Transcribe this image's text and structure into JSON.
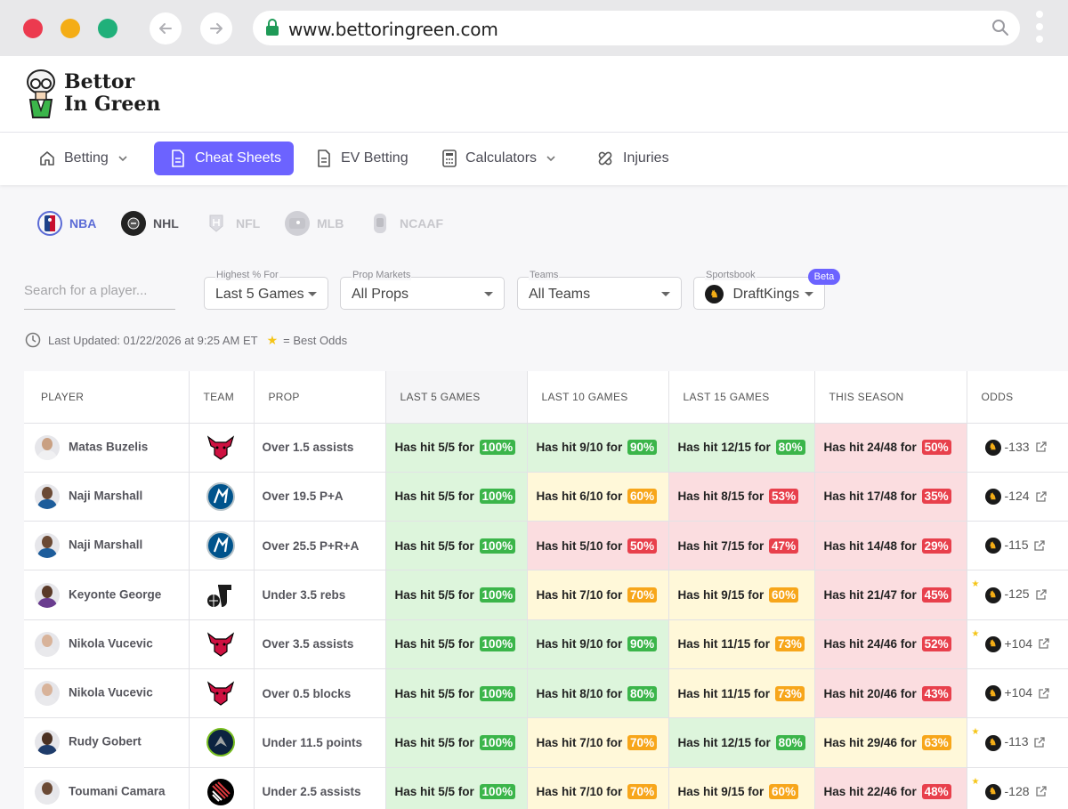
{
  "browser": {
    "url": "www.bettoringreen.com"
  },
  "logo": {
    "line1": "Bettor",
    "line2": "In Green"
  },
  "nav": [
    {
      "label": "Betting",
      "icon": "home-icon",
      "dropdown": true,
      "active": false
    },
    {
      "label": "Cheat Sheets",
      "icon": "document-icon",
      "dropdown": false,
      "active": true
    },
    {
      "label": "EV Betting",
      "icon": "document-icon",
      "dropdown": false,
      "active": false
    },
    {
      "label": "Calculators",
      "icon": "calculator-icon",
      "dropdown": true,
      "active": false
    },
    {
      "label": "Injuries",
      "icon": "bandage-icon",
      "dropdown": false,
      "active": false
    }
  ],
  "sports": [
    {
      "label": "NBA",
      "active": true
    },
    {
      "label": "NHL",
      "active": false
    },
    {
      "label": "NFL",
      "active": false
    },
    {
      "label": "MLB",
      "active": false
    },
    {
      "label": "NCAAF",
      "active": false
    }
  ],
  "filters": {
    "search_placeholder": "Search for a player...",
    "highest": {
      "label": "Highest % For",
      "value": "Last 5 Games"
    },
    "props": {
      "label": "Prop Markets",
      "value": "All Props"
    },
    "teams": {
      "label": "Teams",
      "value": "All Teams"
    },
    "sportsbook": {
      "label": "Sportsbook",
      "value": "DraftKings",
      "badge": "Beta"
    }
  },
  "updated": {
    "text": "Last Updated: 01/22/2026 at 9:25 AM ET",
    "legend": "= Best Odds"
  },
  "table": {
    "headers": [
      "PLAYER",
      "TEAM",
      "PROP",
      "LAST 5 GAMES",
      "LAST 10 GAMES",
      "LAST 15 GAMES",
      "THIS SEASON",
      "ODDS"
    ],
    "rows": [
      {
        "player": "Matas Buzelis",
        "team": "bulls",
        "prop": "Over 1.5 assists",
        "l5": [
          "Has hit 5/5 for",
          "100%",
          "g"
        ],
        "l10": [
          "Has hit 9/10 for",
          "90%",
          "g"
        ],
        "l15": [
          "Has hit 12/15 for",
          "80%",
          "g"
        ],
        "season": [
          "Has hit 24/48 for",
          "50%",
          "r"
        ],
        "odds": "-133",
        "best": false
      },
      {
        "player": "Naji Marshall",
        "team": "mavericks",
        "prop": "Over 19.5 P+A",
        "l5": [
          "Has hit 5/5 for",
          "100%",
          "g"
        ],
        "l10": [
          "Has hit 6/10 for",
          "60%",
          "y"
        ],
        "l15": [
          "Has hit 8/15 for",
          "53%",
          "r"
        ],
        "season": [
          "Has hit 17/48 for",
          "35%",
          "r"
        ],
        "odds": "-124",
        "best": false
      },
      {
        "player": "Naji Marshall",
        "team": "mavericks",
        "prop": "Over 25.5 P+R+A",
        "l5": [
          "Has hit 5/5 for",
          "100%",
          "g"
        ],
        "l10": [
          "Has hit 5/10 for",
          "50%",
          "r"
        ],
        "l15": [
          "Has hit 7/15 for",
          "47%",
          "r"
        ],
        "season": [
          "Has hit 14/48 for",
          "29%",
          "r"
        ],
        "odds": "-115",
        "best": false
      },
      {
        "player": "Keyonte George",
        "team": "jazz",
        "prop": "Under 3.5 rebs",
        "l5": [
          "Has hit 5/5 for",
          "100%",
          "g"
        ],
        "l10": [
          "Has hit 7/10 for",
          "70%",
          "y"
        ],
        "l15": [
          "Has hit 9/15 for",
          "60%",
          "y"
        ],
        "season": [
          "Has hit 21/47 for",
          "45%",
          "r"
        ],
        "odds": "-125",
        "best": true
      },
      {
        "player": "Nikola Vucevic",
        "team": "bulls",
        "prop": "Over 3.5 assists",
        "l5": [
          "Has hit 5/5 for",
          "100%",
          "g"
        ],
        "l10": [
          "Has hit 9/10 for",
          "90%",
          "g"
        ],
        "l15": [
          "Has hit 11/15 for",
          "73%",
          "y"
        ],
        "season": [
          "Has hit 24/46 for",
          "52%",
          "r"
        ],
        "odds": "+104",
        "best": true
      },
      {
        "player": "Nikola Vucevic",
        "team": "bulls",
        "prop": "Over 0.5 blocks",
        "l5": [
          "Has hit 5/5 for",
          "100%",
          "g"
        ],
        "l10": [
          "Has hit 8/10 for",
          "80%",
          "g"
        ],
        "l15": [
          "Has hit 11/15 for",
          "73%",
          "y"
        ],
        "season": [
          "Has hit 20/46 for",
          "43%",
          "r"
        ],
        "odds": "+104",
        "best": false
      },
      {
        "player": "Rudy Gobert",
        "team": "timberwolves",
        "prop": "Under 11.5 points",
        "l5": [
          "Has hit 5/5 for",
          "100%",
          "g"
        ],
        "l10": [
          "Has hit 7/10 for",
          "70%",
          "y"
        ],
        "l15": [
          "Has hit 12/15 for",
          "80%",
          "g"
        ],
        "season": [
          "Has hit 29/46 for",
          "63%",
          "y"
        ],
        "odds": "-113",
        "best": true
      },
      {
        "player": "Toumani Camara",
        "team": "trailblazers",
        "prop": "Under 2.5 assists",
        "l5": [
          "Has hit 5/5 for",
          "100%",
          "g"
        ],
        "l10": [
          "Has hit 7/10 for",
          "70%",
          "y"
        ],
        "l15": [
          "Has hit 9/15 for",
          "60%",
          "y"
        ],
        "season": [
          "Has hit 22/46 for",
          "48%",
          "r"
        ],
        "odds": "-128",
        "best": true
      }
    ]
  },
  "colors": {
    "accent": "#6c63ff",
    "green": "#3bb54a",
    "yellow": "#f7a61b",
    "red": "#e8404c"
  }
}
